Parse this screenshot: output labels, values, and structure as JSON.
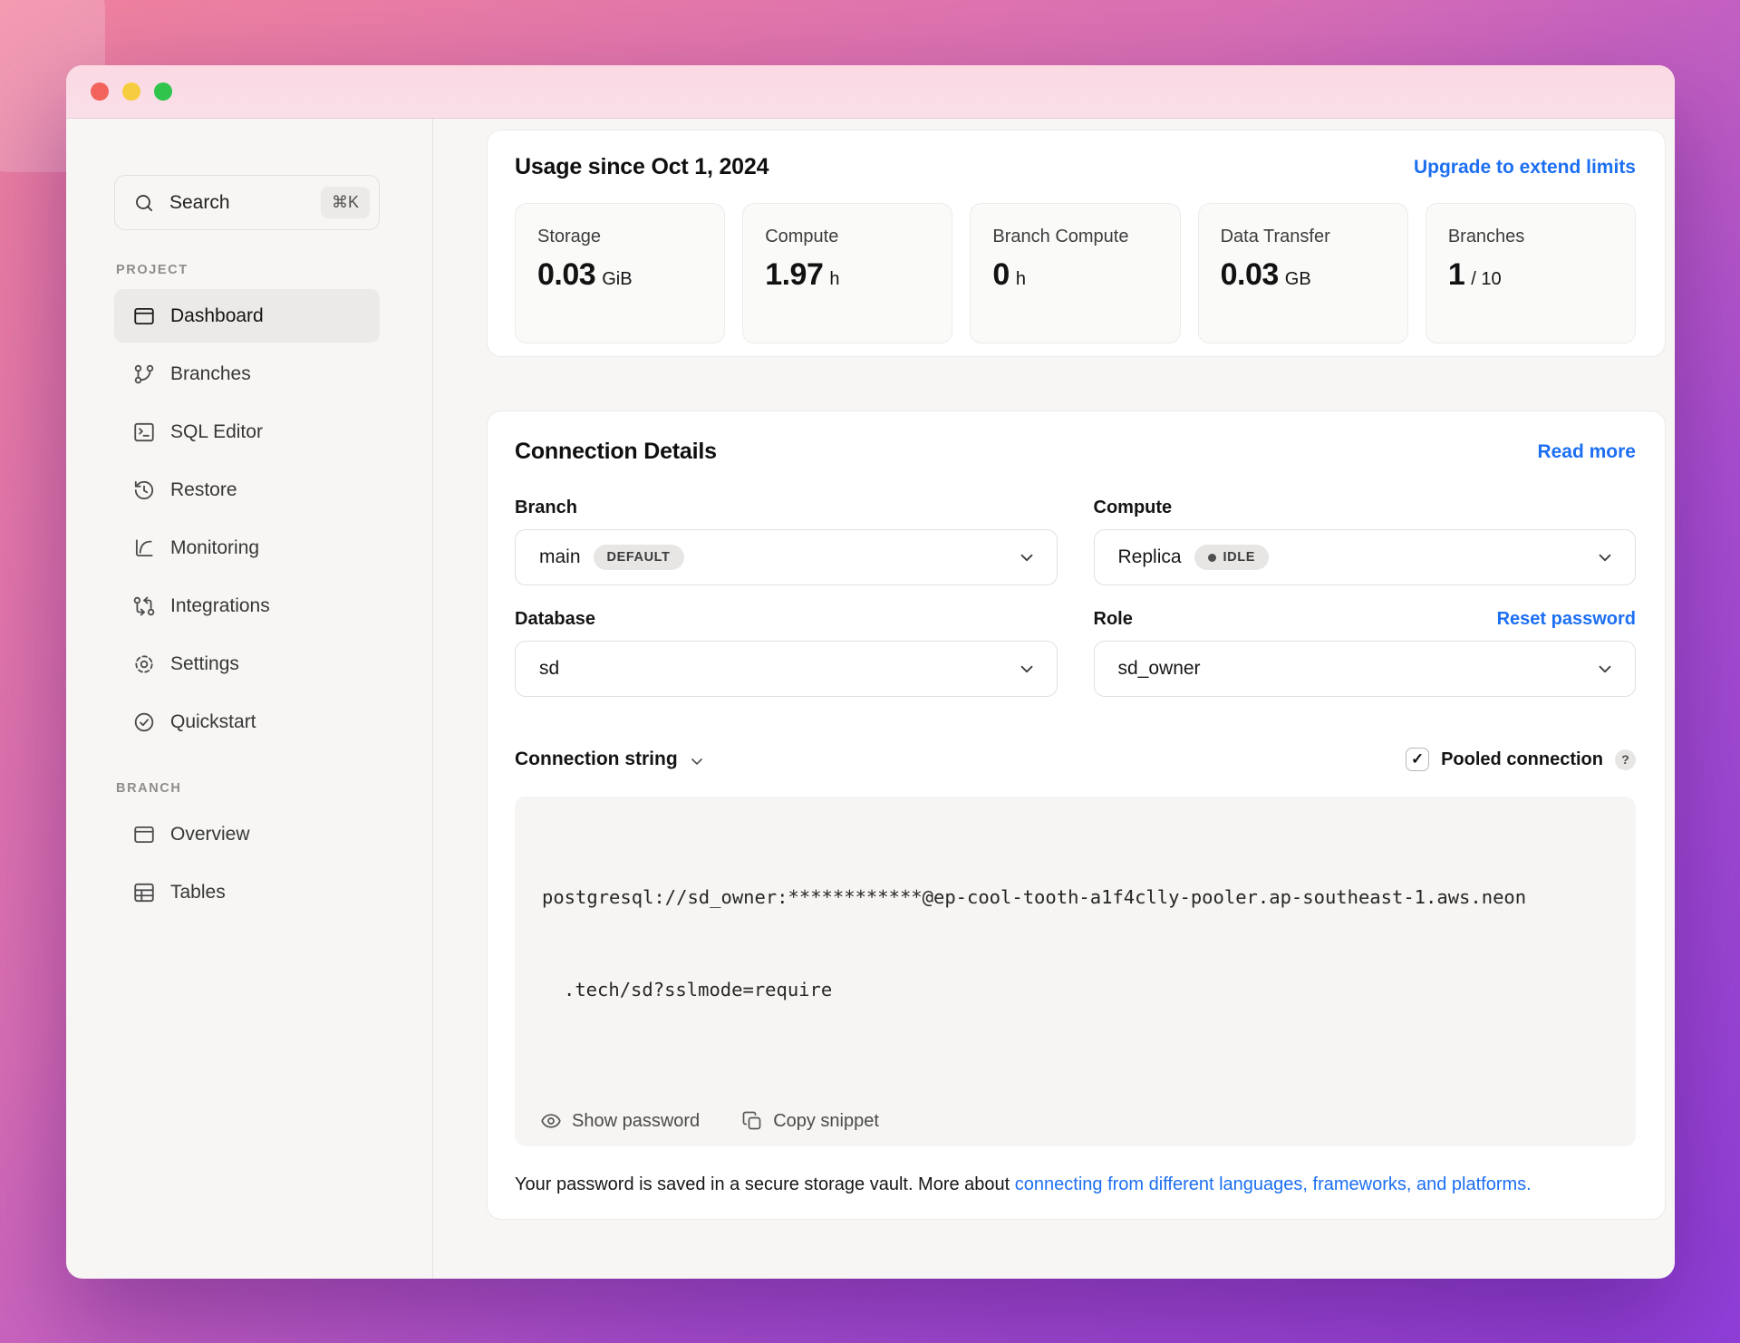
{
  "colors": {
    "accent_blue": "#1d6ff2",
    "background_gradient_start": "#f0829e",
    "background_gradient_end": "#8f3fd8",
    "titlebar_pink": "#fad9e3",
    "traffic_red": "#f2635c",
    "traffic_yellow": "#f6cd3f",
    "traffic_green": "#30c44c"
  },
  "sidebar": {
    "search": {
      "label": "Search",
      "shortcut": "⌘K"
    },
    "sections": [
      {
        "label": "PROJECT",
        "items": [
          {
            "label": "Dashboard",
            "icon": "dashboard-icon",
            "active": true
          },
          {
            "label": "Branches",
            "icon": "git-branch-icon"
          },
          {
            "label": "SQL Editor",
            "icon": "terminal-icon"
          },
          {
            "label": "Restore",
            "icon": "history-clock-icon"
          },
          {
            "label": "Monitoring",
            "icon": "chart-curve-icon"
          },
          {
            "label": "Integrations",
            "icon": "integrations-arrows-icon"
          },
          {
            "label": "Settings",
            "icon": "gear-icon"
          },
          {
            "label": "Quickstart",
            "icon": "check-circle-icon"
          }
        ]
      },
      {
        "label": "BRANCH",
        "items": [
          {
            "label": "Overview",
            "icon": "window-icon"
          },
          {
            "label": "Tables",
            "icon": "table-grid-icon"
          }
        ]
      }
    ]
  },
  "usage": {
    "title": "Usage since Oct 1, 2024",
    "upgrade_link": "Upgrade to extend limits",
    "cards": [
      {
        "label": "Storage",
        "value": "0.03",
        "unit": "GiB"
      },
      {
        "label": "Compute",
        "value": "1.97",
        "unit": "h"
      },
      {
        "label": "Branch Compute",
        "value": "0",
        "unit": "h"
      },
      {
        "label": "Data Transfer",
        "value": "0.03",
        "unit": "GB"
      },
      {
        "label": "Branches",
        "value": "1",
        "unit": "/ 10"
      }
    ]
  },
  "connection": {
    "title": "Connection Details",
    "read_more_link": "Read more",
    "branch": {
      "label": "Branch",
      "value": "main",
      "badge": "DEFAULT"
    },
    "compute": {
      "label": "Compute",
      "value": "Replica",
      "badge": "IDLE"
    },
    "database": {
      "label": "Database",
      "value": "sd"
    },
    "role": {
      "label": "Role",
      "value": "sd_owner",
      "reset_link": "Reset password"
    },
    "string_toggle_label": "Connection string",
    "pooled": {
      "label": "Pooled connection",
      "checked": true,
      "checked_glyph": "✓",
      "help": "?"
    },
    "code": {
      "line1": "postgresql://sd_owner:************@ep-cool-tooth-a1f4clly-pooler.ap-southeast-1.aws.neon",
      "line2": ".tech/sd?sslmode=require"
    },
    "show_password_label": "Show password",
    "copy_snippet_label": "Copy snippet",
    "footer": {
      "text": "Your password is saved in a secure storage vault. More about ",
      "link": "connecting from different languages, frameworks, and platforms."
    }
  }
}
